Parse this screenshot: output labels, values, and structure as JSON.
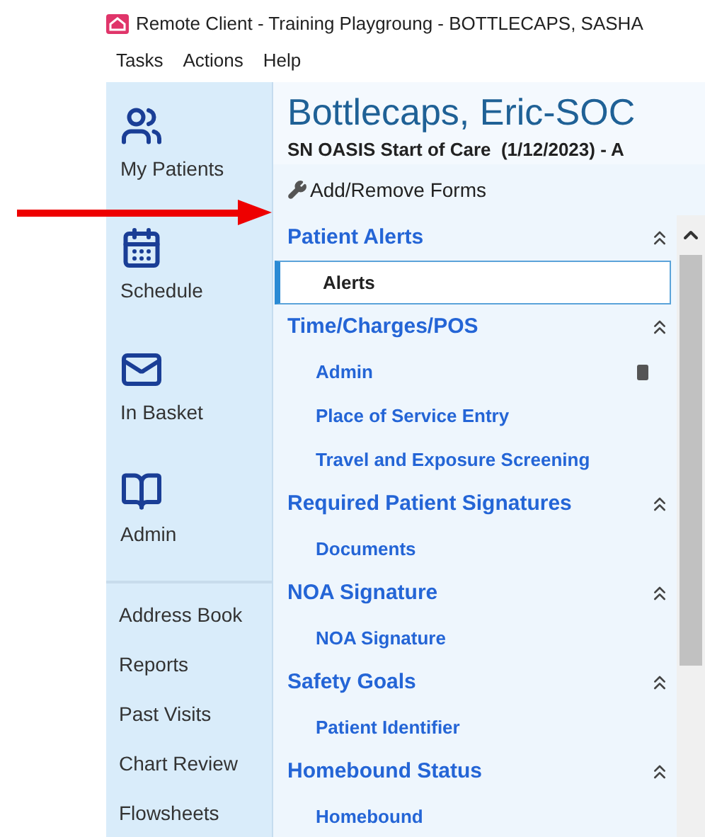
{
  "window": {
    "title": "Remote Client - Training Playgroung - BOTTLECAPS, SASHA"
  },
  "menu": [
    "Tasks",
    "Actions",
    "Help"
  ],
  "sidebar": {
    "primary": [
      {
        "label": "My Patients",
        "kind": "patients"
      },
      {
        "label": "Schedule",
        "kind": "calendar"
      },
      {
        "label": "In Basket",
        "kind": "mail"
      },
      {
        "label": "Admin",
        "kind": "book"
      }
    ],
    "secondary": [
      "Address Book",
      "Reports",
      "Past Visits",
      "Chart Review",
      "Flowsheets"
    ]
  },
  "header": {
    "patient": "Bottlecaps, Eric-SOC",
    "visit": "SN OASIS Start of Care  (1/12/2023) - A"
  },
  "tool": {
    "label": "Add/Remove Forms"
  },
  "sections": [
    {
      "title": "Patient Alerts",
      "expanded": true,
      "items": [
        {
          "label": "Alerts",
          "selected": true,
          "device": false
        }
      ]
    },
    {
      "title": "Time/Charges/POS",
      "expanded": true,
      "items": [
        {
          "label": "Admin",
          "selected": false,
          "device": true
        },
        {
          "label": "Place of Service Entry",
          "selected": false,
          "device": false
        },
        {
          "label": "Travel and Exposure Screening",
          "selected": false,
          "device": false
        }
      ]
    },
    {
      "title": "Required Patient Signatures",
      "expanded": true,
      "items": [
        {
          "label": "Documents",
          "selected": false,
          "device": false
        }
      ]
    },
    {
      "title": "NOA Signature",
      "expanded": true,
      "items": [
        {
          "label": "NOA Signature",
          "selected": false,
          "device": false
        }
      ]
    },
    {
      "title": "Safety Goals",
      "expanded": true,
      "items": [
        {
          "label": "Patient Identifier",
          "selected": false,
          "device": false
        }
      ]
    },
    {
      "title": "Homebound Status",
      "expanded": true,
      "items": [
        {
          "label": "Homebound",
          "selected": false,
          "device": false
        }
      ]
    }
  ]
}
